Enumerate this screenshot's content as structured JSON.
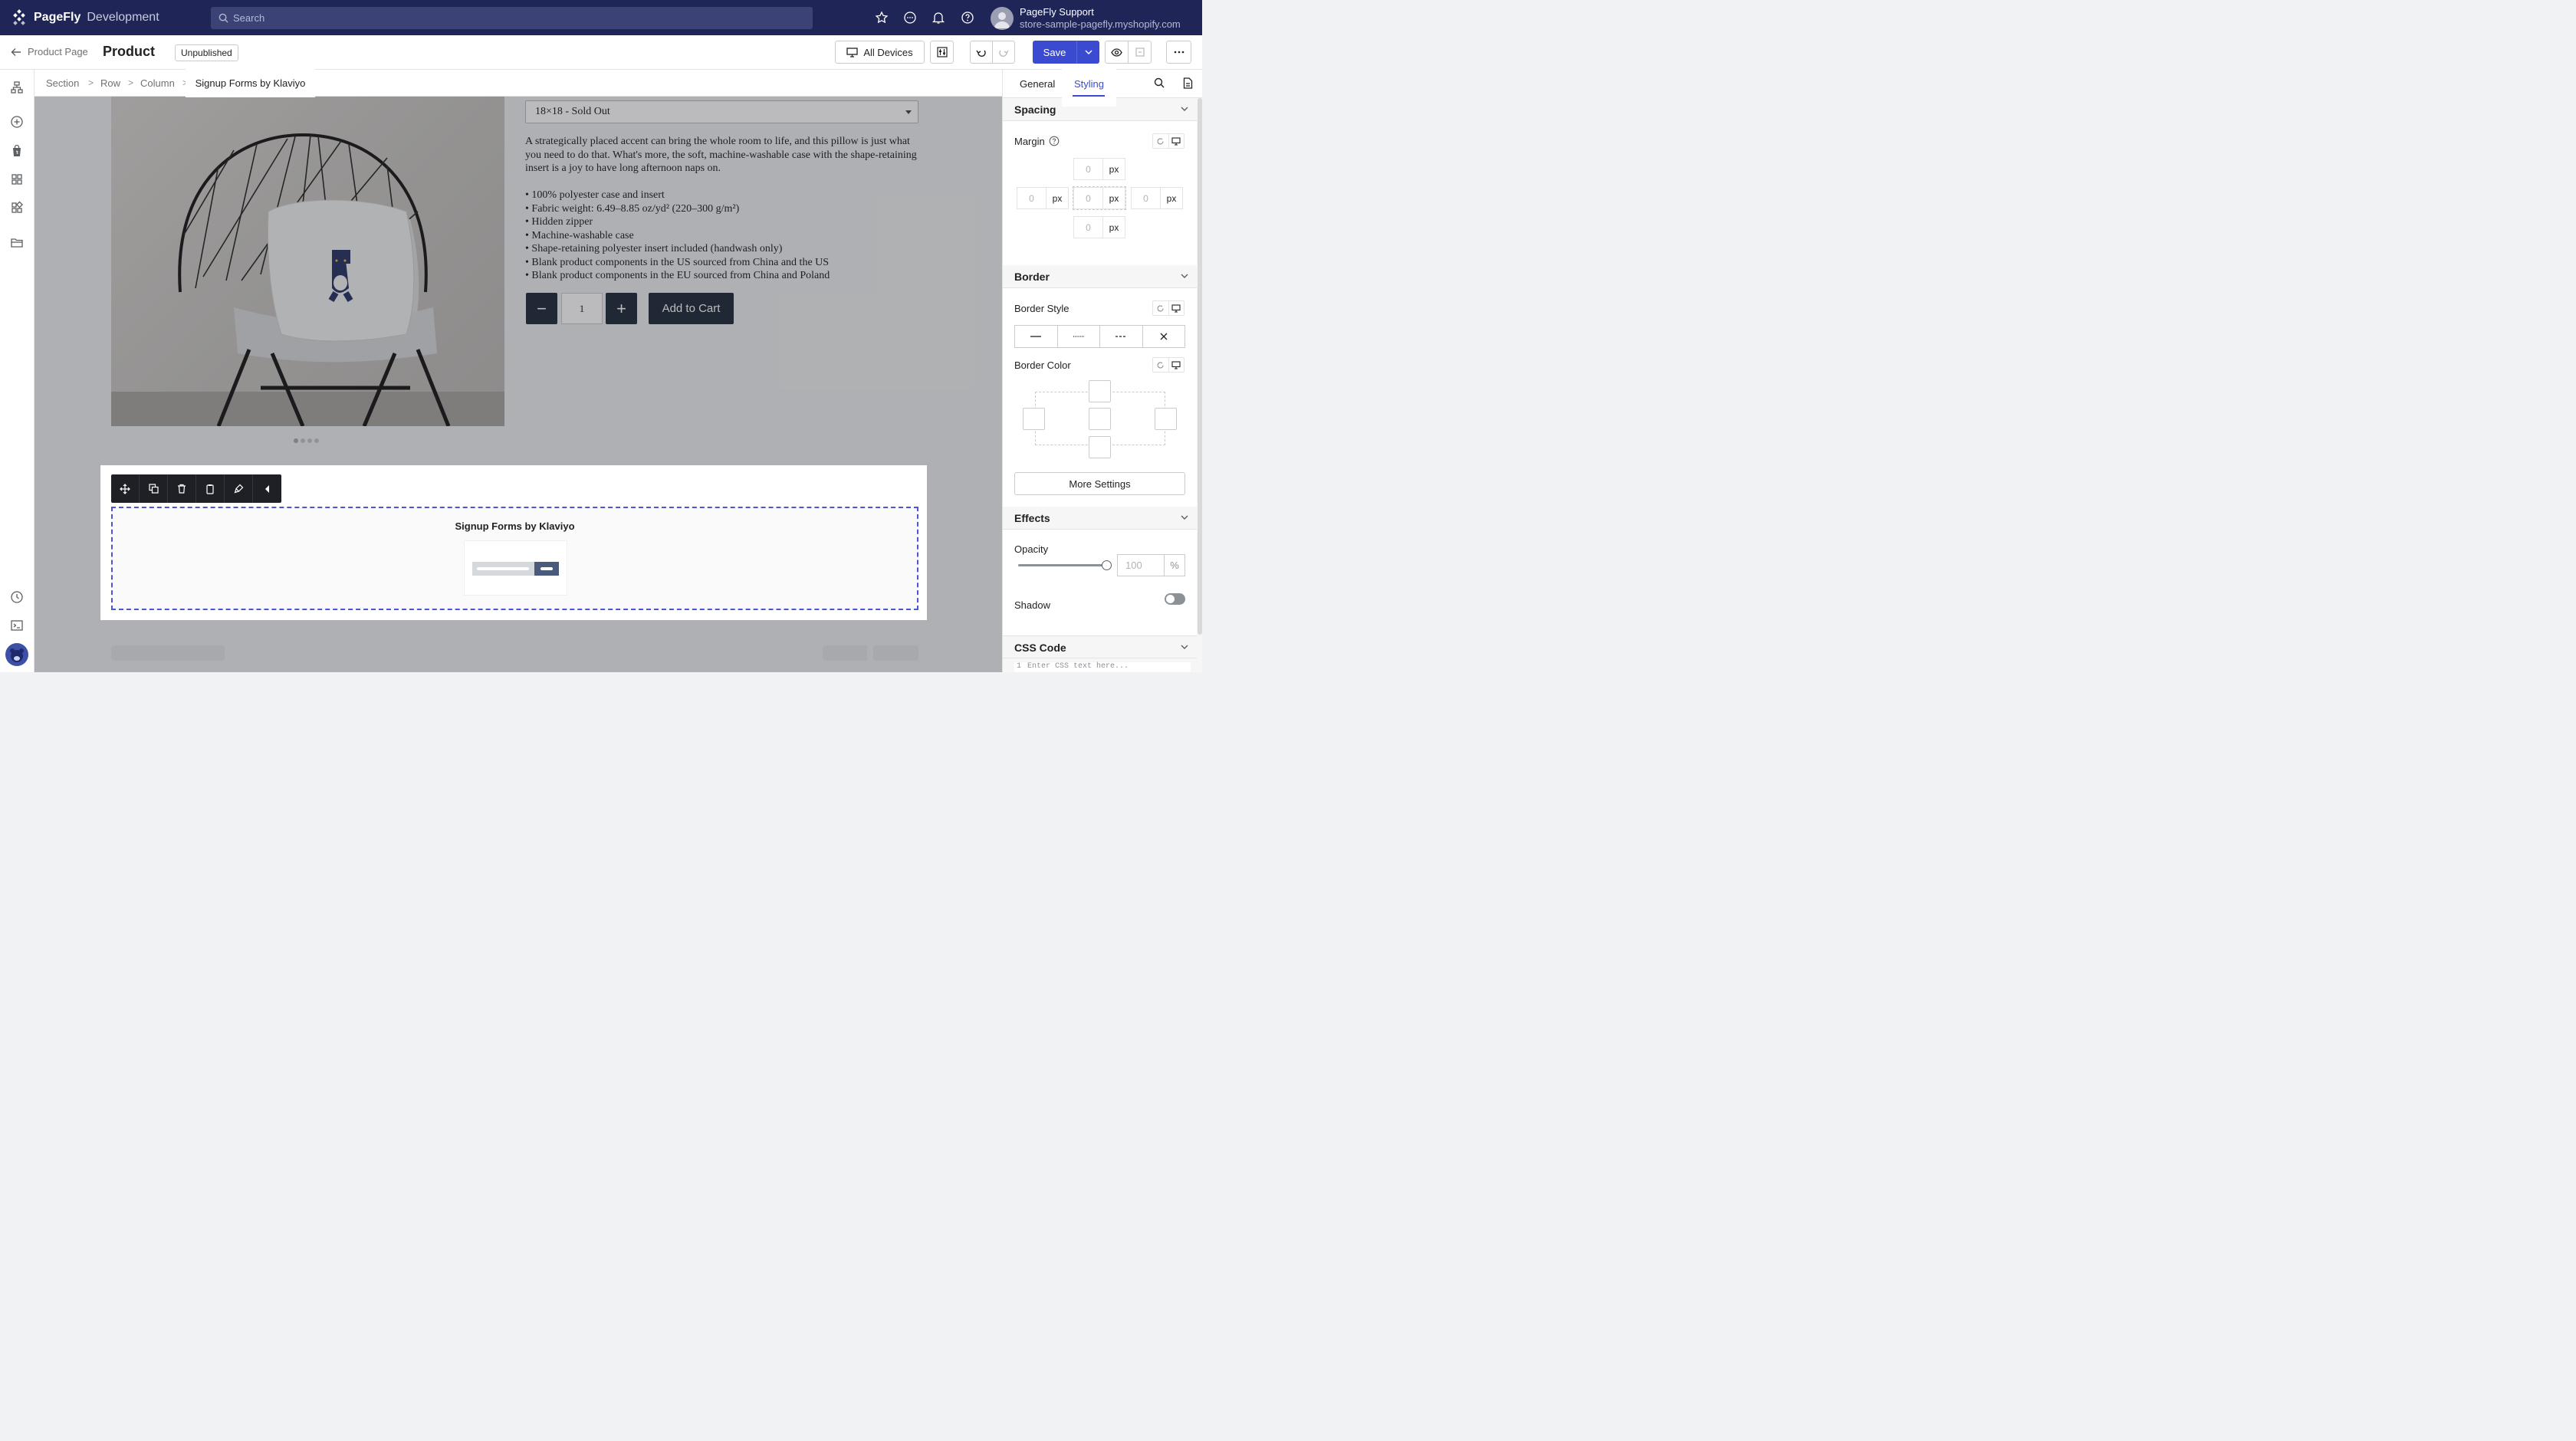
{
  "app": {
    "brand": "PageFly",
    "env": "Development"
  },
  "search": {
    "placeholder": "Search"
  },
  "user": {
    "name": "PageFly Support",
    "store": "store-sample-pagefly.myshopify.com"
  },
  "header": {
    "back_label": "Product Page",
    "title": "Product",
    "status_badge": "Unpublished",
    "device_label": "All Devices",
    "save_label": "Save"
  },
  "breadcrumb": {
    "items": [
      "Section",
      "Row",
      "Column"
    ],
    "active": "Signup Forms by Klaviyo",
    "separator": ">"
  },
  "product": {
    "variant": "18×18 - Sold Out",
    "description": "A strategically placed accent can bring the whole room to life, and this pillow is just what you need to do that. What's more, the soft, machine-washable case with the shape-retaining insert is a joy to have long afternoon naps on.",
    "bullets": [
      "• 100% polyester case and insert",
      "• Fabric weight: 6.49–8.85 oz/yd² (220–300 g/m²)",
      "• Hidden zipper",
      "• Machine-washable case",
      "• Shape-retaining polyester insert included (handwash only)",
      "• Blank product components in the US sourced from China and the US",
      "• Blank product components in the EU sourced from China and Poland"
    ],
    "quantity": "1",
    "minus": "−",
    "plus": "+",
    "add_to_cart": "Add to Cart"
  },
  "klaviyo": {
    "title": "Signup Forms by Klaviyo"
  },
  "panel": {
    "tabs": [
      "General",
      "Styling"
    ],
    "active_tab": "Styling",
    "sections": {
      "spacing": {
        "title": "Spacing",
        "margin_label": "Margin",
        "values": [
          "0",
          "0",
          "0",
          "0",
          "0"
        ],
        "unit": "px"
      },
      "border": {
        "title": "Border",
        "style_label": "Border Style",
        "color_label": "Border Color",
        "more": "More Settings"
      },
      "effects": {
        "title": "Effects",
        "opacity_label": "Opacity",
        "opacity_placeholder": "100",
        "opacity_unit": "%",
        "opacity_value": 1.0,
        "shadow_label": "Shadow",
        "shadow_on": false
      },
      "css": {
        "title": "CSS Code",
        "line": "1",
        "placeholder": "Enter CSS text here..."
      }
    }
  },
  "colors": {
    "topbar": "#1f2557",
    "accent": "#3b4bd1",
    "dark": "#222b3d"
  }
}
